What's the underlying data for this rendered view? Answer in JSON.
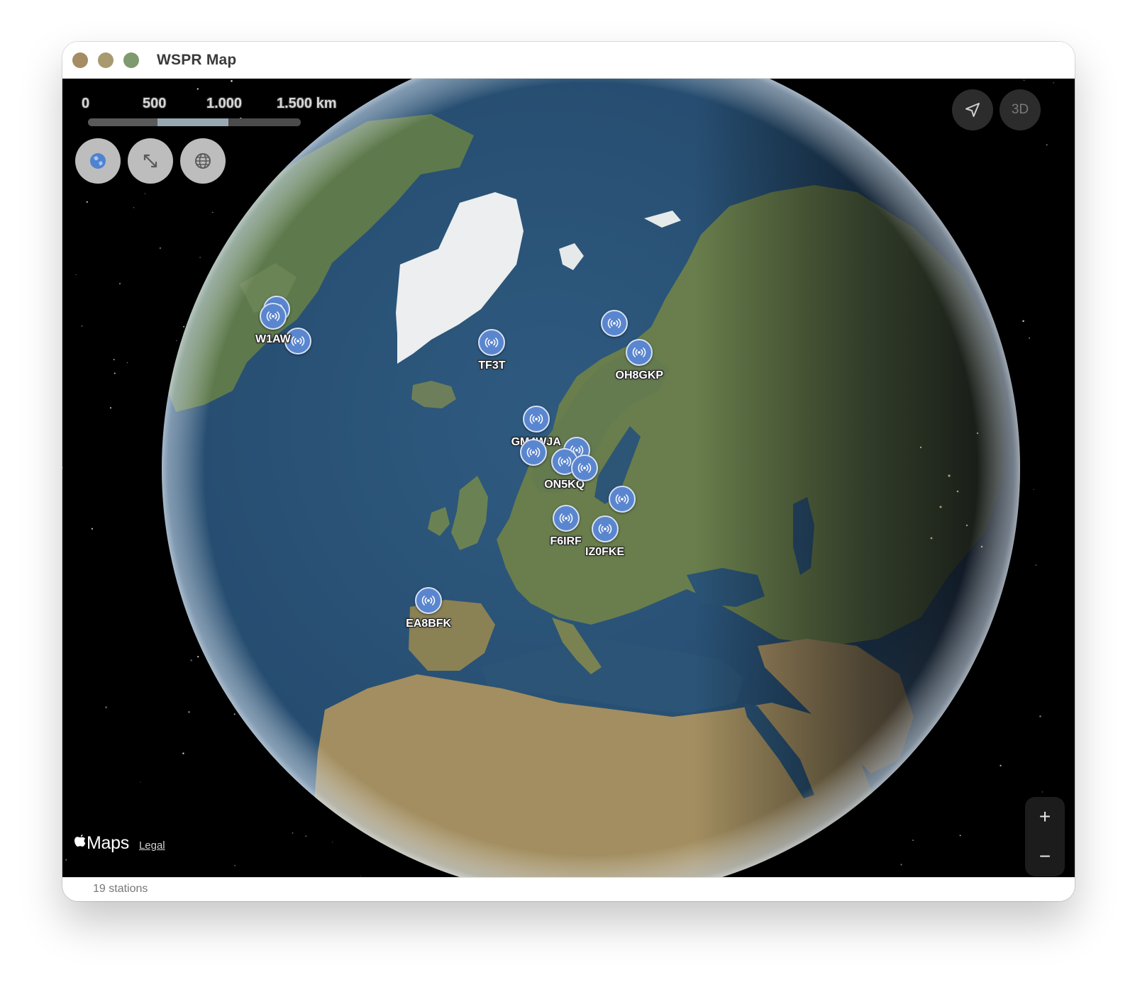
{
  "window": {
    "title": "WSPR Map"
  },
  "scale": {
    "labels": [
      "0",
      "500",
      "1.000",
      "1.500 km"
    ]
  },
  "map_controls": {
    "left_buttons": [
      {
        "name": "globe-view-icon"
      },
      {
        "name": "expand-arrows-icon"
      },
      {
        "name": "globe-grid-icon"
      }
    ],
    "locate_icon": "location-arrow-icon",
    "three_d_label": "3D",
    "zoom_in_label": "+",
    "zoom_out_label": "−"
  },
  "stations": [
    {
      "callsign": "",
      "lon": -63.6,
      "lat": 44.6
    },
    {
      "callsign": "",
      "lon": -73.7,
      "lat": 42.5
    },
    {
      "callsign": "W1AW",
      "lon": -72.7,
      "lat": 41.7
    },
    {
      "callsign": "TF3T",
      "lon": -21.9,
      "lat": 64.1
    },
    {
      "callsign": "",
      "lon": 18.9,
      "lat": 69.6
    },
    {
      "callsign": "OH8GKP",
      "lon": 25.5,
      "lat": 65.0
    },
    {
      "callsign": "GM4WJA",
      "lon": -3.2,
      "lat": 56.0
    },
    {
      "callsign": "",
      "lon": -2.5,
      "lat": 51.5
    },
    {
      "callsign": "",
      "lon": 6.9,
      "lat": 52.4
    },
    {
      "callsign": "ON5KQ",
      "lon": 4.4,
      "lat": 50.8
    },
    {
      "callsign": "",
      "lon": 8.7,
      "lat": 50.1
    },
    {
      "callsign": "",
      "lon": 15.98,
      "lat": 45.8
    },
    {
      "callsign": "F6IRF",
      "lon": 5.4,
      "lat": 43.3
    },
    {
      "callsign": "IZ0FKE",
      "lon": 12.5,
      "lat": 41.9
    },
    {
      "callsign": "EA8BFK",
      "lon": -15.4,
      "lat": 28.1
    }
  ],
  "attribution": {
    "brand": "Maps",
    "legal": "Legal"
  },
  "status": {
    "text": "19 stations"
  }
}
